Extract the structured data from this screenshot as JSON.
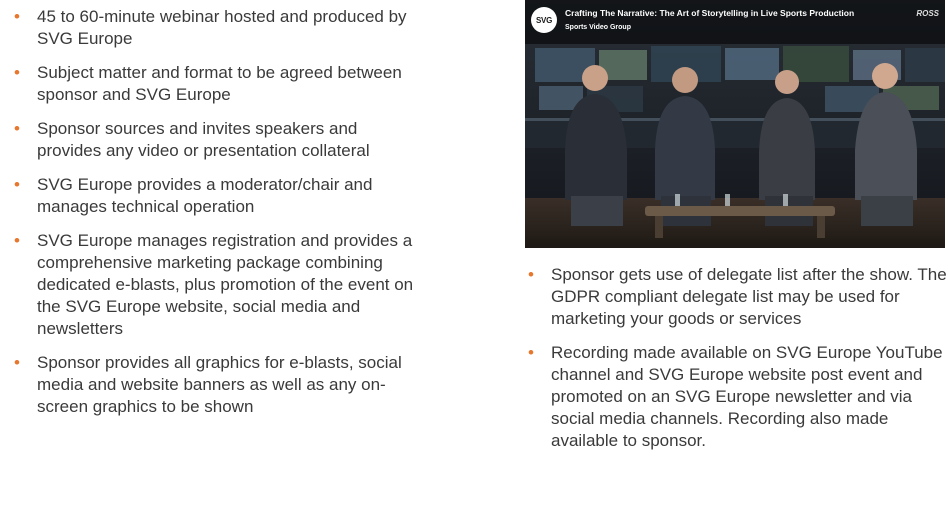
{
  "left_bullets": [
    "45 to 60-minute webinar hosted and produced by SVG Europe",
    "Subject matter and format to be agreed between sponsor and SVG Europe",
    "Sponsor sources and invites speakers and provides any video or presentation collateral",
    "SVG Europe provides a moderator/chair and manages technical operation",
    "SVG Europe manages registration and provides a comprehensive marketing package combining dedicated e-blasts, plus promotion of the event on the SVG Europe website, social media and newsletters",
    "Sponsor provides all graphics for e-blasts, social media and website banners as well as any on-screen graphics to be shown"
  ],
  "right_bullets": [
    "Sponsor gets use of delegate list after the show. The GDPR compliant delegate list may be used for marketing your goods or services",
    "Recording made available on SVG Europe YouTube channel and SVG Europe website post event and promoted on an SVG Europe newsletter and via social media channels. Recording also made available to sponsor."
  ],
  "video": {
    "logo_text": "SVG",
    "title": "Crafting The Narrative: The Art of Storytelling in Live Sports Production",
    "channel": "Sports Video Group",
    "brand": "ROSS"
  },
  "colors": {
    "bullet": "#e8772e",
    "text": "#3a3a3a"
  }
}
